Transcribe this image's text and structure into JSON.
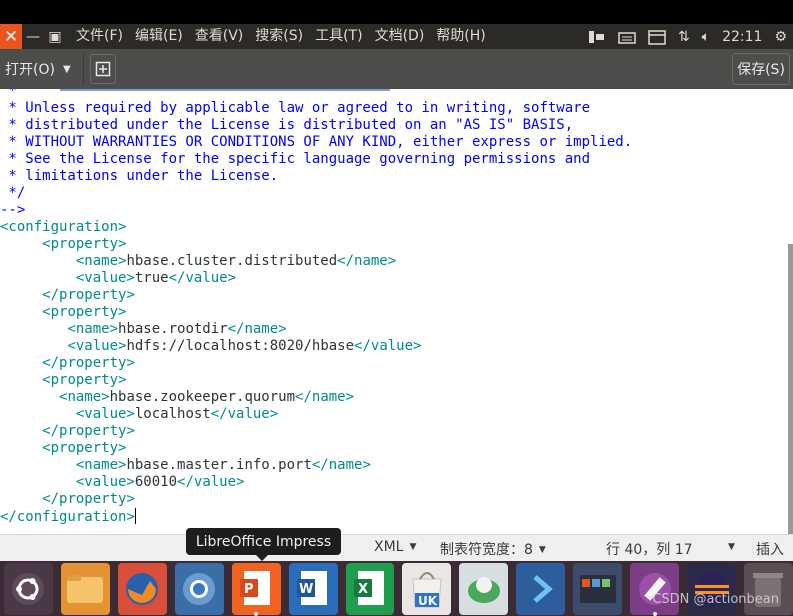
{
  "menubar": {
    "items": [
      "文件(F)",
      "编辑(E)",
      "查看(V)",
      "搜索(S)",
      "工具(T)",
      "文档(D)",
      "帮助(H)"
    ],
    "clock": "22:11"
  },
  "toolbar": {
    "open_label": "打开(O)",
    "save_label": "保存(S)"
  },
  "editor": {
    "lines": [
      [
        {
          "t": " *",
          "c": "com"
        }
      ],
      [
        {
          "t": " * Unless required by applicable law or agreed to in writing, software",
          "c": "com"
        }
      ],
      [
        {
          "t": " * distributed under the License is distributed on an \"AS IS\" BASIS,",
          "c": "com"
        }
      ],
      [
        {
          "t": " * WITHOUT WARRANTIES OR CONDITIONS OF ANY KIND, either express or implied.",
          "c": "com"
        }
      ],
      [
        {
          "t": " * See the License for the specific language governing permissions and",
          "c": "com"
        }
      ],
      [
        {
          "t": " * limitations under the License.",
          "c": "com"
        }
      ],
      [
        {
          "t": " */",
          "c": "com"
        }
      ],
      [
        {
          "t": "-->",
          "c": "com"
        }
      ],
      [
        {
          "t": "<configuration>",
          "c": "tag"
        }
      ],
      [
        {
          "t": "     ",
          "c": "txt"
        },
        {
          "t": "<property>",
          "c": "tag"
        }
      ],
      [
        {
          "t": "         ",
          "c": "txt"
        },
        {
          "t": "<name>",
          "c": "tag"
        },
        {
          "t": "hbase.cluster.distributed",
          "c": "txt"
        },
        {
          "t": "</name>",
          "c": "tag"
        }
      ],
      [
        {
          "t": "         ",
          "c": "txt"
        },
        {
          "t": "<value>",
          "c": "tag"
        },
        {
          "t": "true",
          "c": "txt"
        },
        {
          "t": "</value>",
          "c": "tag"
        }
      ],
      [
        {
          "t": "     ",
          "c": "txt"
        },
        {
          "t": "</property>",
          "c": "tag"
        }
      ],
      [
        {
          "t": "     ",
          "c": "txt"
        },
        {
          "t": "<property>",
          "c": "tag"
        }
      ],
      [
        {
          "t": "        ",
          "c": "txt"
        },
        {
          "t": "<name>",
          "c": "tag"
        },
        {
          "t": "hbase.rootdir",
          "c": "txt"
        },
        {
          "t": "</name>",
          "c": "tag"
        }
      ],
      [
        {
          "t": "        ",
          "c": "txt"
        },
        {
          "t": "<value>",
          "c": "tag"
        },
        {
          "t": "hdfs://localhost:8020/hbase",
          "c": "txt"
        },
        {
          "t": "</value>",
          "c": "tag"
        }
      ],
      [
        {
          "t": "     ",
          "c": "txt"
        },
        {
          "t": "</property>",
          "c": "tag"
        }
      ],
      [
        {
          "t": "     ",
          "c": "txt"
        },
        {
          "t": "<property>",
          "c": "tag"
        }
      ],
      [
        {
          "t": "       ",
          "c": "txt"
        },
        {
          "t": "<name>",
          "c": "tag"
        },
        {
          "t": "hbase.zookeeper.quorum",
          "c": "txt"
        },
        {
          "t": "</name>",
          "c": "tag"
        }
      ],
      [
        {
          "t": "         ",
          "c": "txt"
        },
        {
          "t": "<value>",
          "c": "tag"
        },
        {
          "t": "localhost",
          "c": "txt"
        },
        {
          "t": "</value>",
          "c": "tag"
        }
      ],
      [
        {
          "t": "     ",
          "c": "txt"
        },
        {
          "t": "</property>",
          "c": "tag"
        }
      ],
      [
        {
          "t": "     ",
          "c": "txt"
        },
        {
          "t": "<property>",
          "c": "tag"
        }
      ],
      [
        {
          "t": "         ",
          "c": "txt"
        },
        {
          "t": "<name>",
          "c": "tag"
        },
        {
          "t": "hbase.master.info.port",
          "c": "txt"
        },
        {
          "t": "</name>",
          "c": "tag"
        }
      ],
      [
        {
          "t": "         ",
          "c": "txt"
        },
        {
          "t": "<value>",
          "c": "tag"
        },
        {
          "t": "60010",
          "c": "txt"
        },
        {
          "t": "</value>",
          "c": "tag"
        }
      ],
      [
        {
          "t": "     ",
          "c": "txt"
        },
        {
          "t": "</property>",
          "c": "tag"
        }
      ],
      [
        {
          "t": "</configuration>",
          "c": "tag"
        }
      ]
    ],
    "colors": {
      "comment": "#0000ff",
      "tag": "#008b8b",
      "text": "#2e3436"
    }
  },
  "statusbar": {
    "language": "XML",
    "tab_width": "制表符宽度：8",
    "position": "行 40，列 17",
    "insert_mode": "插入"
  },
  "tooltip": "LibreOffice Impress",
  "dock": {
    "items": [
      "ubuntu-logo-icon",
      "files-icon",
      "firefox-icon",
      "chromium-icon",
      "impress-icon",
      "writer-icon",
      "calc-icon",
      "software-center-icon",
      "ubuntu-one-icon",
      "remote-desktop-icon",
      "terminal-icon",
      "text-editor-icon",
      "eclipse-icon",
      "trash-icon"
    ],
    "software_badge": "UK"
  },
  "watermark": "CSDN @actionbean",
  "accent": "#e95420"
}
